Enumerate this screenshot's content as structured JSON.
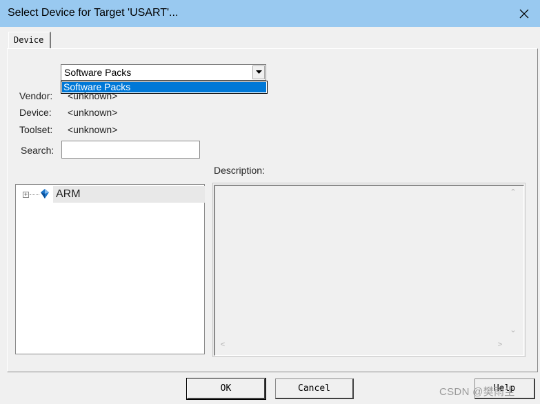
{
  "window": {
    "title": "Select Device for Target 'USART'..."
  },
  "tab": {
    "label": "Device"
  },
  "device_source": {
    "selected": "Software Packs",
    "options": [
      "Software Packs"
    ],
    "highlighted_option": "Software Packs"
  },
  "info": {
    "vendor_label": "Vendor:",
    "vendor_value": "<unknown>",
    "device_label": "Device:",
    "device_value": "<unknown>",
    "toolset_label": "Toolset:",
    "toolset_value": "<unknown>"
  },
  "search": {
    "label": "Search:",
    "value": ""
  },
  "tree": {
    "items": [
      {
        "label": "ARM",
        "expanded": false
      }
    ]
  },
  "description": {
    "label": "Description:",
    "text": ""
  },
  "buttons": {
    "ok": "OK",
    "cancel": "Cancel",
    "help": "Help"
  },
  "watermark": {
    "text": "CSDN @樊雨尘"
  },
  "colors": {
    "titlebar": "#99c9f0",
    "selection": "#0078d7",
    "dialog_bg": "#f0f0f0"
  }
}
